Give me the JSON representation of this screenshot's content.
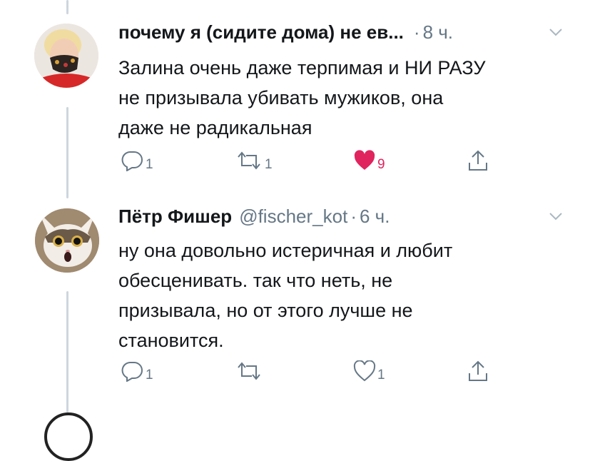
{
  "tweets": [
    {
      "name": "почему я (сидите дома) не ев...",
      "handle": "",
      "dot": "·",
      "time": "8 ч.",
      "text": [
        "Залина очень даже терпимая и НИ РАЗУ",
        "не призывала убивать мужиков, она",
        "даже не радикальная"
      ],
      "reply_count": "1",
      "retweet_count": "1",
      "like_count": "9",
      "liked": true
    },
    {
      "name": "Пётр Фишер",
      "handle": "@fischer_kot",
      "dot": "·",
      "time": "6 ч.",
      "text": [
        "ну она довольно истеричная и любит",
        "обесценивать. так что неть, не",
        "призывала, но от этого лучше не",
        "становится."
      ],
      "reply_count": "1",
      "retweet_count": "",
      "like_count": "1",
      "liked": false
    }
  ],
  "colors": {
    "text": "#14171a",
    "secondary": "#657786",
    "like": "#e0245e",
    "thread_line": "#ccd6dd"
  },
  "icons": [
    "reply-icon",
    "retweet-icon",
    "heart-icon",
    "share-icon",
    "chevron-down-icon"
  ]
}
